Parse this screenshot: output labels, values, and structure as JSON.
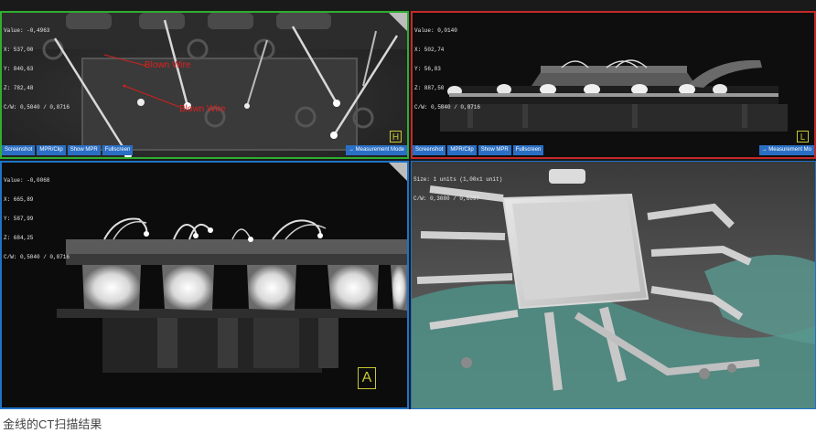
{
  "viewports": {
    "h": {
      "info": [
        "Value: -0,4963",
        "X: 537,00",
        "Y: 840,63",
        "Z: 782,48",
        "C/W: 0,5040 / 0,8716"
      ],
      "toolbar": [
        "Screenshot",
        "MPR/Clip",
        "Show MPR",
        "Fullscreen"
      ],
      "measurement": "→ Measurement Mode",
      "orientation": "H",
      "annotations": [
        "Blown Wire",
        "Blown Wire"
      ],
      "border_color": "#2fae2f"
    },
    "l": {
      "info": [
        "Value: 0,0140",
        "X: 502,74",
        "Y: 56,83",
        "Z: 887,50",
        "C/W: 0,5040 / 0,8716"
      ],
      "toolbar": [
        "Screenshot",
        "MPR/Clip",
        "Show MPR",
        "Fullscreen"
      ],
      "measurement": "→ Measurement Mo",
      "orientation": "L",
      "border_color": "#c62828"
    },
    "a": {
      "info": [
        "Value: -0,0068",
        "X: 665,89",
        "Y: 587,99",
        "Z: 684,25",
        "C/W: 0,5040 / 0,8716"
      ],
      "orientation": "A",
      "border_color": "#1e73c8"
    },
    "d3": {
      "info": [
        "Size: 1 units (1,00x1 unit)",
        "C/W: 0,3080 / 0,6097"
      ],
      "border_color": "#1e73c8"
    }
  },
  "caption": "金线的CT扫描结果",
  "icons": [
    "corner-triangle-icon"
  ]
}
